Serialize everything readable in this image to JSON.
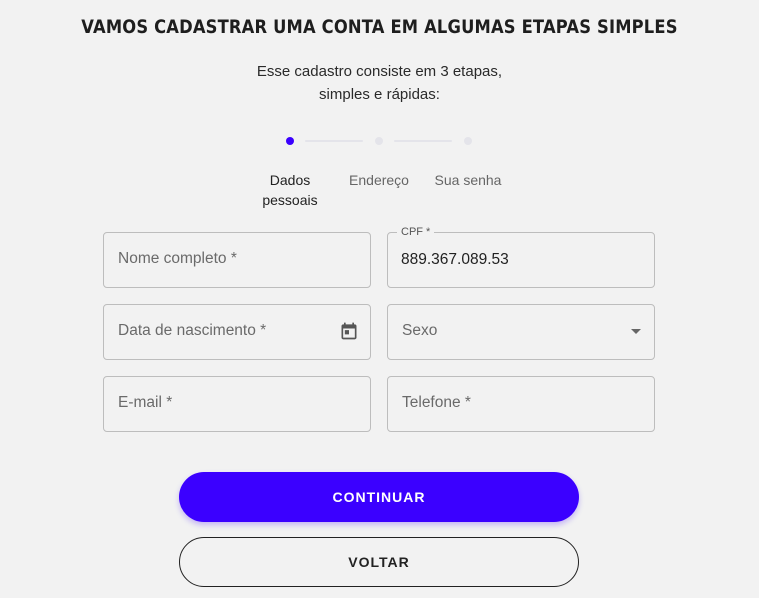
{
  "header": {
    "title": "VAMOS CADASTRAR UMA CONTA EM ALGUMAS ETAPAS SIMPLES",
    "subtitle_line1": "Esse cadastro consiste em 3 etapas,",
    "subtitle_line2": "simples e rápidas:"
  },
  "stepper": {
    "current_step": 1,
    "steps": [
      {
        "label_line1": "Dados",
        "label_line2": "pessoais",
        "active": true
      },
      {
        "label_line1": "Endereço",
        "label_line2": "",
        "active": false
      },
      {
        "label_line1": "Sua senha",
        "label_line2": "",
        "active": false
      }
    ]
  },
  "form": {
    "full_name": {
      "placeholder": "Nome completo *",
      "value": ""
    },
    "cpf": {
      "label": "CPF *",
      "value": "889.367.089.53"
    },
    "birth_date": {
      "placeholder": "Data de nascimento *",
      "icon": "calendar-icon"
    },
    "sex": {
      "placeholder": "Sexo",
      "icon": "caret-down-icon"
    },
    "email": {
      "placeholder": "E-mail *"
    },
    "phone": {
      "placeholder": "Telefone *"
    }
  },
  "actions": {
    "continue_label": "CONTINUAR",
    "back_label": "VOLTAR"
  },
  "colors": {
    "accent": "#3b00ff",
    "background": "#f2f2f2",
    "border": "#bdbdbd",
    "inactive_step": "#e4e4ea"
  }
}
